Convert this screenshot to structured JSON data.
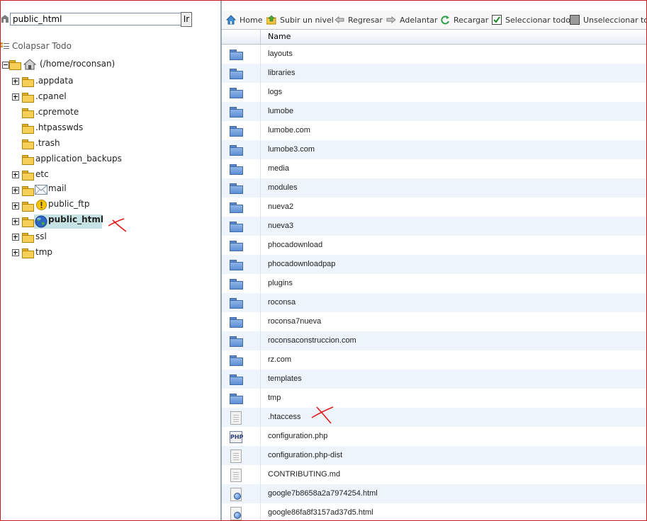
{
  "path_bar": {
    "value": "public_html",
    "go_label": "Ir"
  },
  "tree": {
    "collapse_label": "Colapsar Todo",
    "root_label": "(/home/roconsan)",
    "items": [
      {
        "label": ".appdata",
        "expandable": true,
        "icon": "folder-icon"
      },
      {
        "label": ".cpanel",
        "expandable": true,
        "icon": "folder-icon"
      },
      {
        "label": ".cpremote",
        "expandable": false,
        "icon": "folder-icon"
      },
      {
        "label": ".htpasswds",
        "expandable": false,
        "icon": "folder-icon"
      },
      {
        "label": ".trash",
        "expandable": false,
        "icon": "folder-icon"
      },
      {
        "label": "application_backups",
        "expandable": false,
        "icon": "folder-icon"
      },
      {
        "label": "etc",
        "expandable": true,
        "icon": "folder-icon"
      },
      {
        "label": "mail",
        "expandable": true,
        "icon": "mail-icon"
      },
      {
        "label": "public_ftp",
        "expandable": true,
        "icon": "warning-icon"
      },
      {
        "label": "public_html",
        "expandable": true,
        "icon": "globe-icon",
        "selected": true
      },
      {
        "label": "ssl",
        "expandable": true,
        "icon": "folder-icon"
      },
      {
        "label": "tmp",
        "expandable": true,
        "icon": "folder-icon"
      }
    ]
  },
  "toolbar": {
    "home": "Home",
    "up": "Subir un nivel",
    "back": "Regresar",
    "forward": "Adelantar",
    "reload": "Recargar",
    "select_all": "Seleccionar todo",
    "unselect_all": "Unseleccionar todo"
  },
  "grid": {
    "column_name": "Name",
    "rows": [
      {
        "name": "layouts",
        "type": "folder"
      },
      {
        "name": "libraries",
        "type": "folder"
      },
      {
        "name": "logs",
        "type": "folder"
      },
      {
        "name": "lumobe",
        "type": "folder"
      },
      {
        "name": "lumobe.com",
        "type": "folder"
      },
      {
        "name": "lumobe3.com",
        "type": "folder"
      },
      {
        "name": "media",
        "type": "folder"
      },
      {
        "name": "modules",
        "type": "folder"
      },
      {
        "name": "nueva2",
        "type": "folder"
      },
      {
        "name": "nueva3",
        "type": "folder"
      },
      {
        "name": "phocadownload",
        "type": "folder"
      },
      {
        "name": "phocadownloadpap",
        "type": "folder"
      },
      {
        "name": "plugins",
        "type": "folder"
      },
      {
        "name": "roconsa",
        "type": "folder"
      },
      {
        "name": "roconsa7nueva",
        "type": "folder"
      },
      {
        "name": "roconsaconstruccion.com",
        "type": "folder"
      },
      {
        "name": "rz.com",
        "type": "folder"
      },
      {
        "name": "templates",
        "type": "folder"
      },
      {
        "name": "tmp",
        "type": "folder"
      },
      {
        "name": ".htaccess",
        "type": "text"
      },
      {
        "name": "configuration.php",
        "type": "php"
      },
      {
        "name": "configuration.php-dist",
        "type": "text"
      },
      {
        "name": "CONTRIBUTING.md",
        "type": "text"
      },
      {
        "name": "google7b8658a2a7974254.html",
        "type": "html"
      },
      {
        "name": "google86fa8f3157ad37d5.html",
        "type": "html"
      }
    ]
  },
  "colors": {
    "accent": "#c51f1f",
    "alt_row": "#edf4fb",
    "selected": "#c7e2e4",
    "folder_blue": "#5e8fd4",
    "folder_yellow": "#f6cf58"
  }
}
